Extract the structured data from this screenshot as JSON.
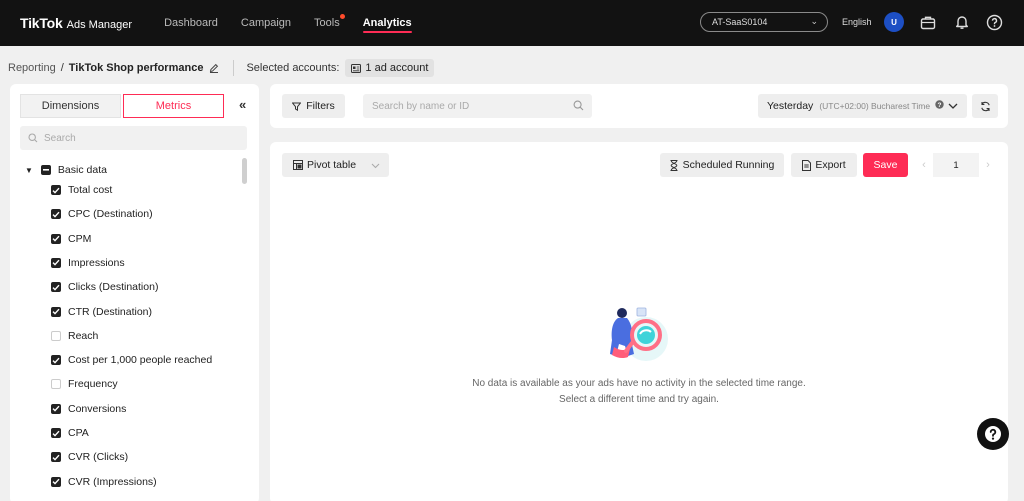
{
  "nav": {
    "brand": "TikTok",
    "brand_suffix": "Ads Manager",
    "links": [
      "Dashboard",
      "Campaign",
      "Tools",
      "Analytics"
    ],
    "active": "Analytics",
    "account": "AT-SaaS0104",
    "language": "English",
    "avatar_initial": "U"
  },
  "breadcrumb": {
    "root": "Reporting",
    "separator": "/",
    "current": "TikTok Shop performance",
    "selected_label": "Selected accounts:",
    "selected_value": "1 ad account"
  },
  "sidebar": {
    "tabs": [
      "Dimensions",
      "Metrics"
    ],
    "active_tab": "Metrics",
    "collapse": "«",
    "search_placeholder": "Search",
    "group": "Basic data",
    "metrics": [
      {
        "label": "Total cost",
        "checked": true
      },
      {
        "label": "CPC (Destination)",
        "checked": true
      },
      {
        "label": "CPM",
        "checked": true
      },
      {
        "label": "Impressions",
        "checked": true
      },
      {
        "label": "Clicks (Destination)",
        "checked": true
      },
      {
        "label": "CTR (Destination)",
        "checked": true
      },
      {
        "label": "Reach",
        "checked": false
      },
      {
        "label": "Cost per 1,000 people reached",
        "checked": true
      },
      {
        "label": "Frequency",
        "checked": false
      },
      {
        "label": "Conversions",
        "checked": true
      },
      {
        "label": "CPA",
        "checked": true
      },
      {
        "label": "CVR (Clicks)",
        "checked": true
      },
      {
        "label": "CVR (Impressions)",
        "checked": true
      }
    ]
  },
  "toolbar": {
    "filters": "Filters",
    "search_placeholder": "Search by name or ID",
    "date": "Yesterday",
    "timezone": "(UTC+02:00) Bucharest Time"
  },
  "report": {
    "pivot": "Pivot table",
    "scheduled": "Scheduled Running",
    "export": "Export",
    "save": "Save",
    "page": "1",
    "empty_line1": "No data is available as your ads have no activity in the selected time range.",
    "empty_line2": "Select a different time and try again."
  },
  "colors": {
    "accent": "#fe2c55",
    "nav_bg": "#121212",
    "avatar": "#1d4fc4"
  }
}
